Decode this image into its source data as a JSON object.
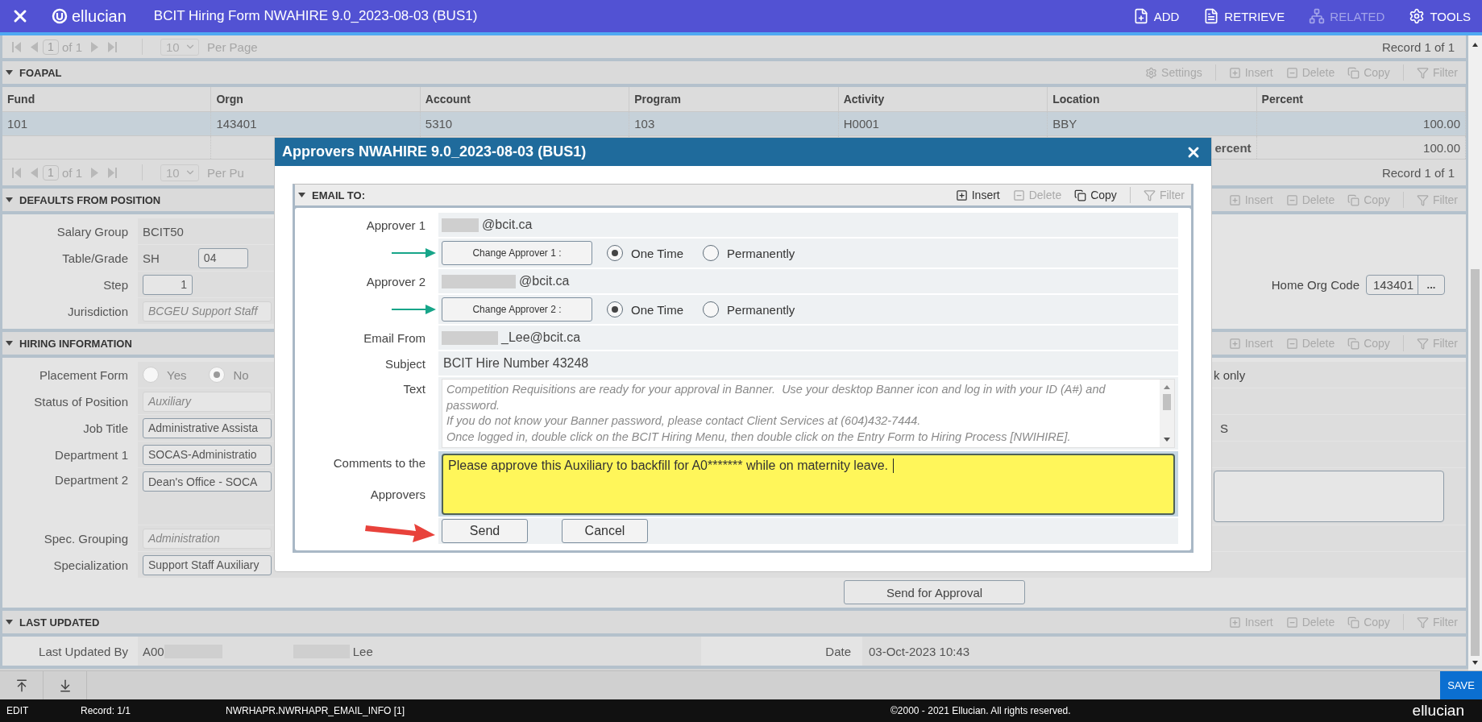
{
  "app_bar": {
    "brand": "ellucian",
    "title": "BCIT Hiring Form NWAHIRE 9.0_2023-08-03 (BUS1)",
    "actions": [
      {
        "kind": "add",
        "label": "ADD",
        "disabled": false
      },
      {
        "kind": "retrieve",
        "label": "RETRIEVE",
        "disabled": false
      },
      {
        "kind": "related",
        "label": "RELATED",
        "disabled": true
      },
      {
        "kind": "tools",
        "label": "TOOLS",
        "disabled": false
      }
    ]
  },
  "top_pager": {
    "page": "1",
    "of": "of 1",
    "per_page": "10",
    "per_page_label": "Per Page",
    "record": "Record 1 of 1"
  },
  "foapal": {
    "title": "FOAPAL",
    "actions": [
      {
        "kind": "settings",
        "label": "Settings",
        "disabled": true
      },
      {
        "kind": "insert",
        "label": "Insert",
        "disabled": true
      },
      {
        "kind": "delete",
        "label": "Delete",
        "disabled": true
      },
      {
        "kind": "copy",
        "label": "Copy",
        "disabled": true
      },
      {
        "kind": "filter",
        "label": "Filter",
        "disabled": true
      }
    ],
    "columns": [
      "Fund",
      "Orgn",
      "Account",
      "Program",
      "Activity",
      "Location",
      "Percent"
    ],
    "rows": [
      {
        "selected": true,
        "cells": [
          "101",
          "143401",
          "5310",
          "103",
          "H0001",
          "BBY",
          "100.00"
        ]
      }
    ],
    "total": {
      "label": "ercent",
      "value": "100.00"
    },
    "pager": {
      "page": "1",
      "of": "of 1",
      "per_page": "10",
      "per_page_label": "Per Pu",
      "record": "Record 1 of 1"
    }
  },
  "defaults": {
    "title": "DEFAULTS FROM POSITION",
    "actions": [
      {
        "kind": "insert",
        "label": "Insert",
        "disabled": true
      },
      {
        "kind": "delete",
        "label": "Delete",
        "disabled": true
      },
      {
        "kind": "copy",
        "label": "Copy",
        "disabled": true
      },
      {
        "kind": "filter",
        "label": "Filter",
        "disabled": true
      }
    ],
    "fields": [
      {
        "kind": "plain",
        "label": "Salary Group",
        "value": "BCIT50"
      },
      {
        "kind": "grade",
        "label": "Table/Grade",
        "value": "SH",
        "value2": "04"
      },
      {
        "kind": "number",
        "label": "Step",
        "value": "1"
      },
      {
        "kind": "readonly",
        "label": "Jurisdiction",
        "value": "BCGEU Support Staff"
      }
    ],
    "home_org": {
      "label": "Home Org Code",
      "value": "143401",
      "lookup": "..."
    }
  },
  "hiring": {
    "title": "HIRING INFORMATION",
    "actions": [
      {
        "kind": "insert",
        "label": "Insert",
        "disabled": true
      },
      {
        "kind": "delete",
        "label": "Delete",
        "disabled": true
      },
      {
        "kind": "copy",
        "label": "Copy",
        "disabled": true
      },
      {
        "kind": "filter",
        "label": "Filter",
        "disabled": true
      }
    ],
    "fields": [
      {
        "kind": "radio",
        "label": "Placement Form",
        "options": [
          {
            "label": "Yes",
            "selected": false
          },
          {
            "label": "No",
            "selected": true
          }
        ]
      },
      {
        "kind": "readonly",
        "label": "Status of Position",
        "value": "Auxiliary"
      },
      {
        "kind": "input",
        "label": "Job Title",
        "value": "Administrative Assista"
      },
      {
        "kind": "input",
        "label": "Department 1",
        "value": "SOCAS-Administratio"
      },
      {
        "kind": "tall",
        "label": "Department 2",
        "value": "Dean's Office - SOCA"
      },
      {
        "kind": "readonly",
        "label": "Spec. Grouping",
        "value": "Administration"
      },
      {
        "kind": "input",
        "label": "Specialization",
        "value": "Support Staff Auxiliary"
      }
    ],
    "right_note": "k only",
    "right_flag": "S",
    "approval_button": "Send for Approval"
  },
  "last_updated": {
    "title": "LAST UPDATED",
    "actions": [
      {
        "kind": "insert",
        "label": "Insert",
        "disabled": true
      },
      {
        "kind": "delete",
        "label": "Delete",
        "disabled": true
      },
      {
        "kind": "copy",
        "label": "Copy",
        "disabled": true
      },
      {
        "kind": "filter",
        "label": "Filter",
        "disabled": true
      }
    ],
    "label": "Last Updated By",
    "id_prefix": "A00",
    "name": "Lee",
    "date_label": "Date",
    "date": "03-Oct-2023 10:43"
  },
  "toolbar": {
    "save": "SAVE"
  },
  "status_bar": {
    "mode": "EDIT",
    "record": "Record: 1/1",
    "block": "NWRHAPR.NWRHAPR_EMAIL_INFO [1]",
    "copyright": "©2000 - 2021 Ellucian. All rights reserved.",
    "brand": "ellucian"
  },
  "modal": {
    "title": "Approvers NWAHIRE 9.0_2023-08-03 (BUS1)",
    "section": "EMAIL TO:",
    "actions": [
      {
        "kind": "insert",
        "label": "Insert",
        "disabled": false
      },
      {
        "kind": "delete",
        "label": "Delete",
        "disabled": true
      },
      {
        "kind": "copy",
        "label": "Copy",
        "disabled": false
      },
      {
        "kind": "filter",
        "label": "Filter",
        "disabled": true
      }
    ],
    "rows": [
      {
        "kind": "email",
        "label": "Approver 1",
        "value": "@bcit.ca"
      },
      {
        "kind": "change",
        "button": "Change Approver 1 :",
        "annotation": {
          "color": "#17a589"
        },
        "options": [
          {
            "label": "One Time",
            "selected": true
          },
          {
            "label": "Permanently",
            "selected": false
          }
        ]
      },
      {
        "kind": "email",
        "label": "Approver 2",
        "value": "@bcit.ca"
      },
      {
        "kind": "change",
        "button": "Change Approver 2 :",
        "annotation": {
          "color": "#17a589"
        },
        "options": [
          {
            "label": "One Time",
            "selected": true
          },
          {
            "label": "Permanently",
            "selected": false
          }
        ]
      },
      {
        "kind": "email",
        "label": "Email From",
        "value": "_Lee@bcit.ca"
      },
      {
        "kind": "text",
        "label": "Subject",
        "value": "BCIT Hire Number 43248"
      },
      {
        "kind": "message",
        "label": "Text",
        "lines": [
          "Competition Requisitions are ready for your approval in Banner.  Use your desktop Banner icon and log in with your ID (A#) and",
          "password.",
          "If you do not know your Banner password, please contact Client Services at (604)432-7444.",
          "Once logged in, double click on the BCIT Hiring Menu, then double click on the Entry Form to Hiring Process [NWIHIRE]."
        ]
      },
      {
        "kind": "comments",
        "label_lines": [
          "Comments to the",
          "Approvers"
        ],
        "value": "Please approve this Auxiliary to backfill for A0******* while on maternity leave."
      }
    ],
    "buttons": [
      {
        "label": "Send",
        "annotation": {
          "color": "#e8423b"
        }
      },
      {
        "label": "Cancel"
      }
    ]
  }
}
